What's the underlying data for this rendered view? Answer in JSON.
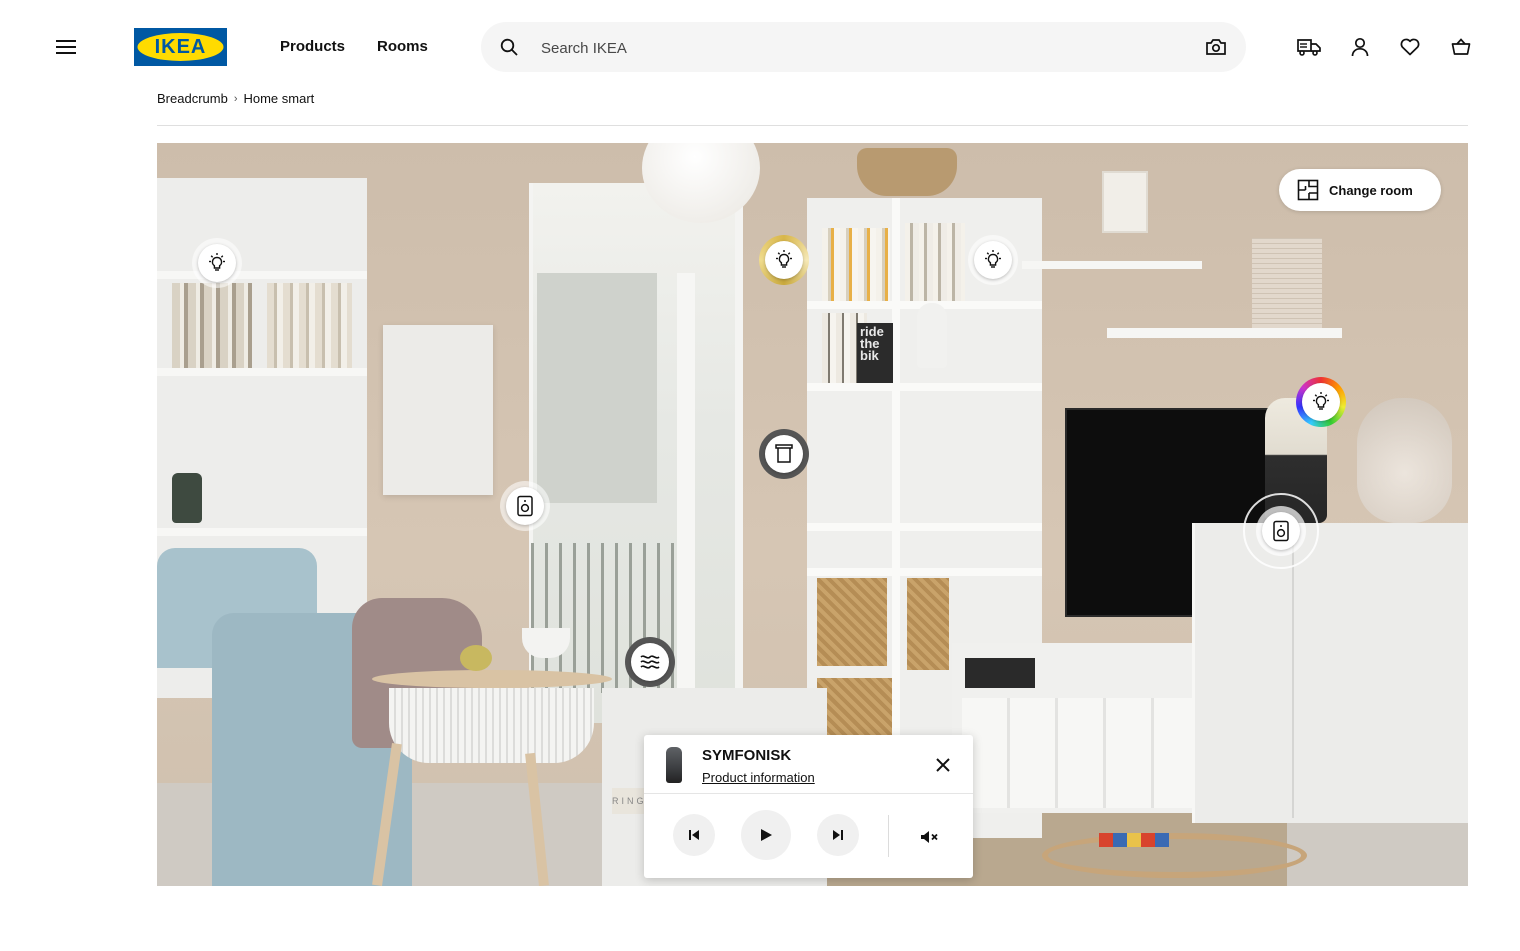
{
  "header": {
    "logo_text": "IKEA",
    "nav": [
      "Products",
      "Rooms"
    ],
    "search_placeholder": "Search IKEA"
  },
  "breadcrumb": [
    "Breadcrumb",
    "Home smart"
  ],
  "scene": {
    "change_room_label": "Change room",
    "book_text": "ride the bik",
    "box_text": "RING"
  },
  "player": {
    "product_name": "SYMFONISK",
    "product_link": "Product information"
  },
  "colors": {
    "ikea_blue": "#0058a3",
    "ikea_yellow": "#ffdb00",
    "hotspot_gold": "#d8b64a"
  }
}
